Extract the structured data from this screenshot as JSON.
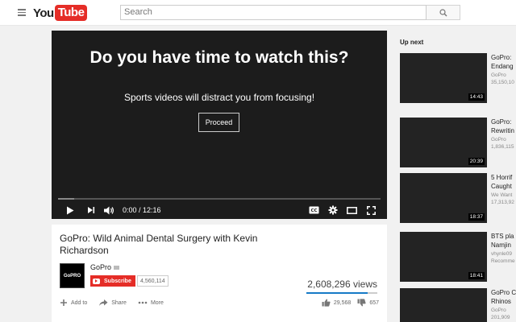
{
  "header": {
    "logo_you": "You",
    "logo_tube": "Tube",
    "search_placeholder": "Search"
  },
  "player": {
    "overlay_title": "Do you have time to watch this?",
    "overlay_message": "Sports videos will distract you from focusing!",
    "proceed_label": "Proceed",
    "time": "0:00 / 12:16",
    "progress_fraction": 0.05
  },
  "video": {
    "title": "GoPro: Wild Animal Dental Surgery with Kevin Richardson",
    "channel": "GoPro",
    "avatar_text": "GoPRO",
    "subscribe_label": "Subscribe",
    "subscriber_count": "4,560,114",
    "views": "2,608,296 views",
    "actions": {
      "add_to": "Add to",
      "share": "Share",
      "more": "More"
    },
    "likes": "29,568",
    "dislikes": "657"
  },
  "sidebar": {
    "heading": "Up next",
    "items": [
      {
        "title": "GoPro:",
        "title2": "Endang",
        "channel": "GoPro",
        "views": "35,150,10",
        "duration": "14:43"
      },
      {
        "title": "GoPro:",
        "title2": "Rewritin",
        "channel": "GoPro",
        "views": "1,836,115",
        "duration": "20:39"
      },
      {
        "title": "5 Horrif",
        "title2": "Caught",
        "channel": "We Want",
        "views": "17,313,92",
        "duration": "18:37"
      },
      {
        "title": "BTS pla",
        "title2": "Namjin",
        "channel": "vhynle09",
        "views": "Recomme",
        "duration": "18:41"
      },
      {
        "title": "GoPro C",
        "title2": "Rhinos",
        "channel": "GoPro",
        "views": "201,909",
        "duration": ""
      }
    ]
  },
  "colors": {
    "brand_red": "#e52d27",
    "link_blue": "#167ac6",
    "player_bg": "#1c1c1c"
  }
}
